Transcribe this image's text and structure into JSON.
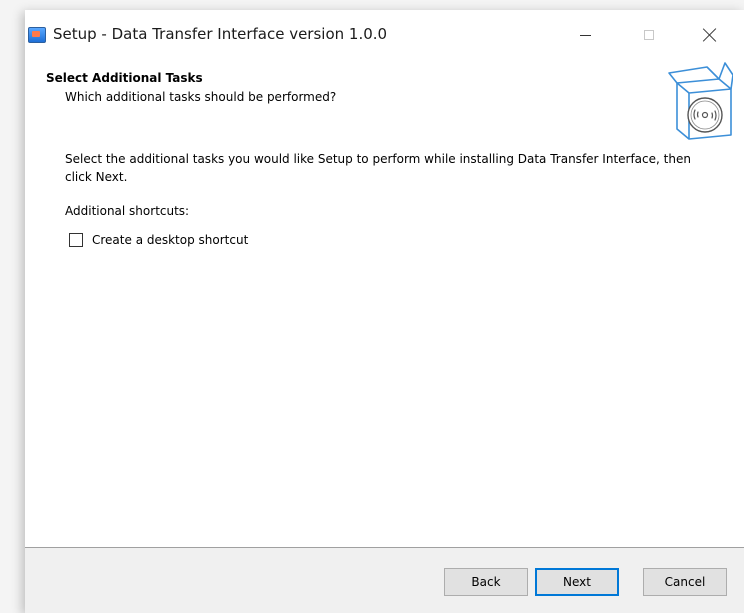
{
  "window": {
    "title": "Setup - Data Transfer Interface version 1.0.0",
    "icon": "setup-app-icon",
    "controls": [
      "minimize-icon",
      "maximize-icon",
      "close-icon"
    ]
  },
  "header": {
    "title": "Select Additional Tasks",
    "subtitle": "Which additional tasks should be performed?",
    "image": "software-box-icon"
  },
  "main": {
    "description": "Select the additional tasks you would like Setup to perform while installing Data Transfer Interface, then click Next.",
    "group_label": "Additional shortcuts:",
    "tasks": [
      {
        "label": "Create a desktop shortcut",
        "checked": false
      }
    ]
  },
  "footer": {
    "back_label": "Back",
    "next_label": "Next",
    "cancel_label": "Cancel",
    "default_button": "Next",
    "accent_color": "#0078d7"
  }
}
